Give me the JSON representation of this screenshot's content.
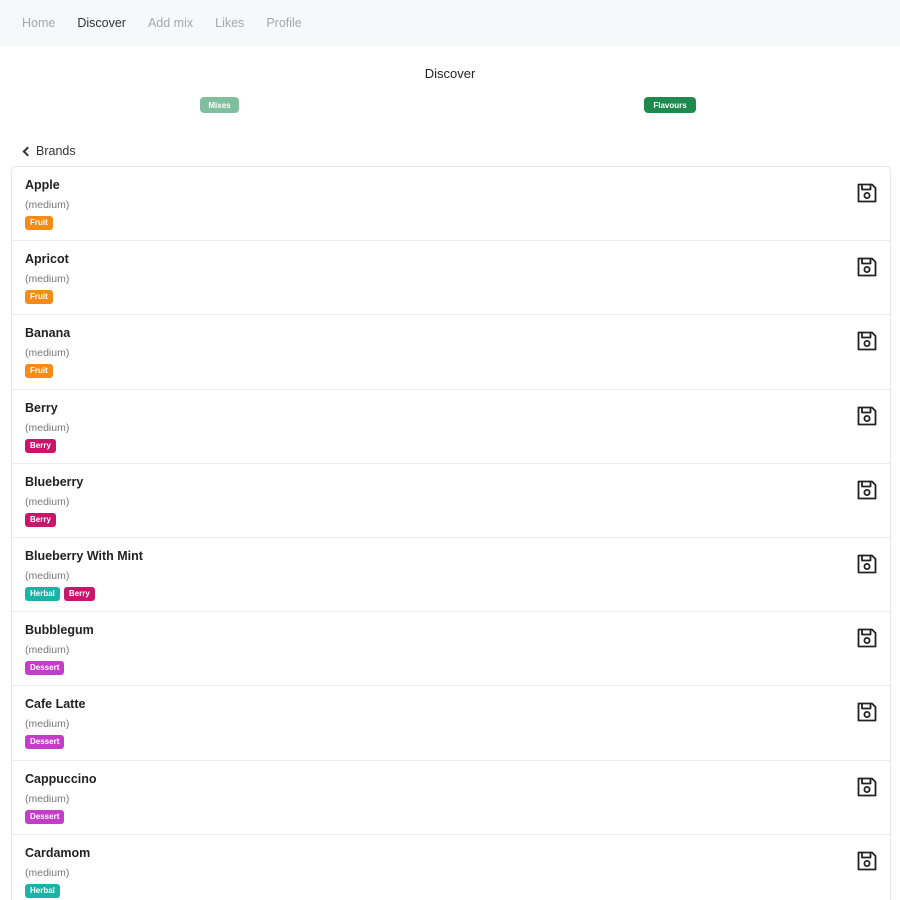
{
  "nav": {
    "items": [
      {
        "label": "Home",
        "active": false
      },
      {
        "label": "Discover",
        "active": true
      },
      {
        "label": "Add mix",
        "active": false
      },
      {
        "label": "Likes",
        "active": false
      },
      {
        "label": "Profile",
        "active": false
      }
    ]
  },
  "page": {
    "title": "Discover",
    "segments": {
      "mixes": "Mixes",
      "flavours": "Flavours"
    },
    "back_label": "Brands"
  },
  "colors": {
    "Fruit": "#f58c1a",
    "Berry": "#c9166c",
    "Herbal": "#1ab3a7",
    "Dessert": "#c43cc9",
    "segment_inactive": "#7fbf9e",
    "segment_active": "#1e8a4d"
  },
  "flavours": [
    {
      "name": "Apple",
      "strength": "(medium)",
      "tags": [
        "Fruit"
      ]
    },
    {
      "name": "Apricot",
      "strength": "(medium)",
      "tags": [
        "Fruit"
      ]
    },
    {
      "name": "Banana",
      "strength": "(medium)",
      "tags": [
        "Fruit"
      ]
    },
    {
      "name": "Berry",
      "strength": "(medium)",
      "tags": [
        "Berry"
      ]
    },
    {
      "name": "Blueberry",
      "strength": "(medium)",
      "tags": [
        "Berry"
      ]
    },
    {
      "name": "Blueberry With Mint",
      "strength": "(medium)",
      "tags": [
        "Herbal",
        "Berry"
      ]
    },
    {
      "name": "Bubblegum",
      "strength": "(medium)",
      "tags": [
        "Dessert"
      ]
    },
    {
      "name": "Cafe Latte",
      "strength": "(medium)",
      "tags": [
        "Dessert"
      ]
    },
    {
      "name": "Cappuccino",
      "strength": "(medium)",
      "tags": [
        "Dessert"
      ]
    },
    {
      "name": "Cardamom",
      "strength": "(medium)",
      "tags": [
        "Herbal"
      ]
    }
  ],
  "icons": {
    "save": "floppy-disk-icon",
    "back": "chevron-left-icon"
  }
}
